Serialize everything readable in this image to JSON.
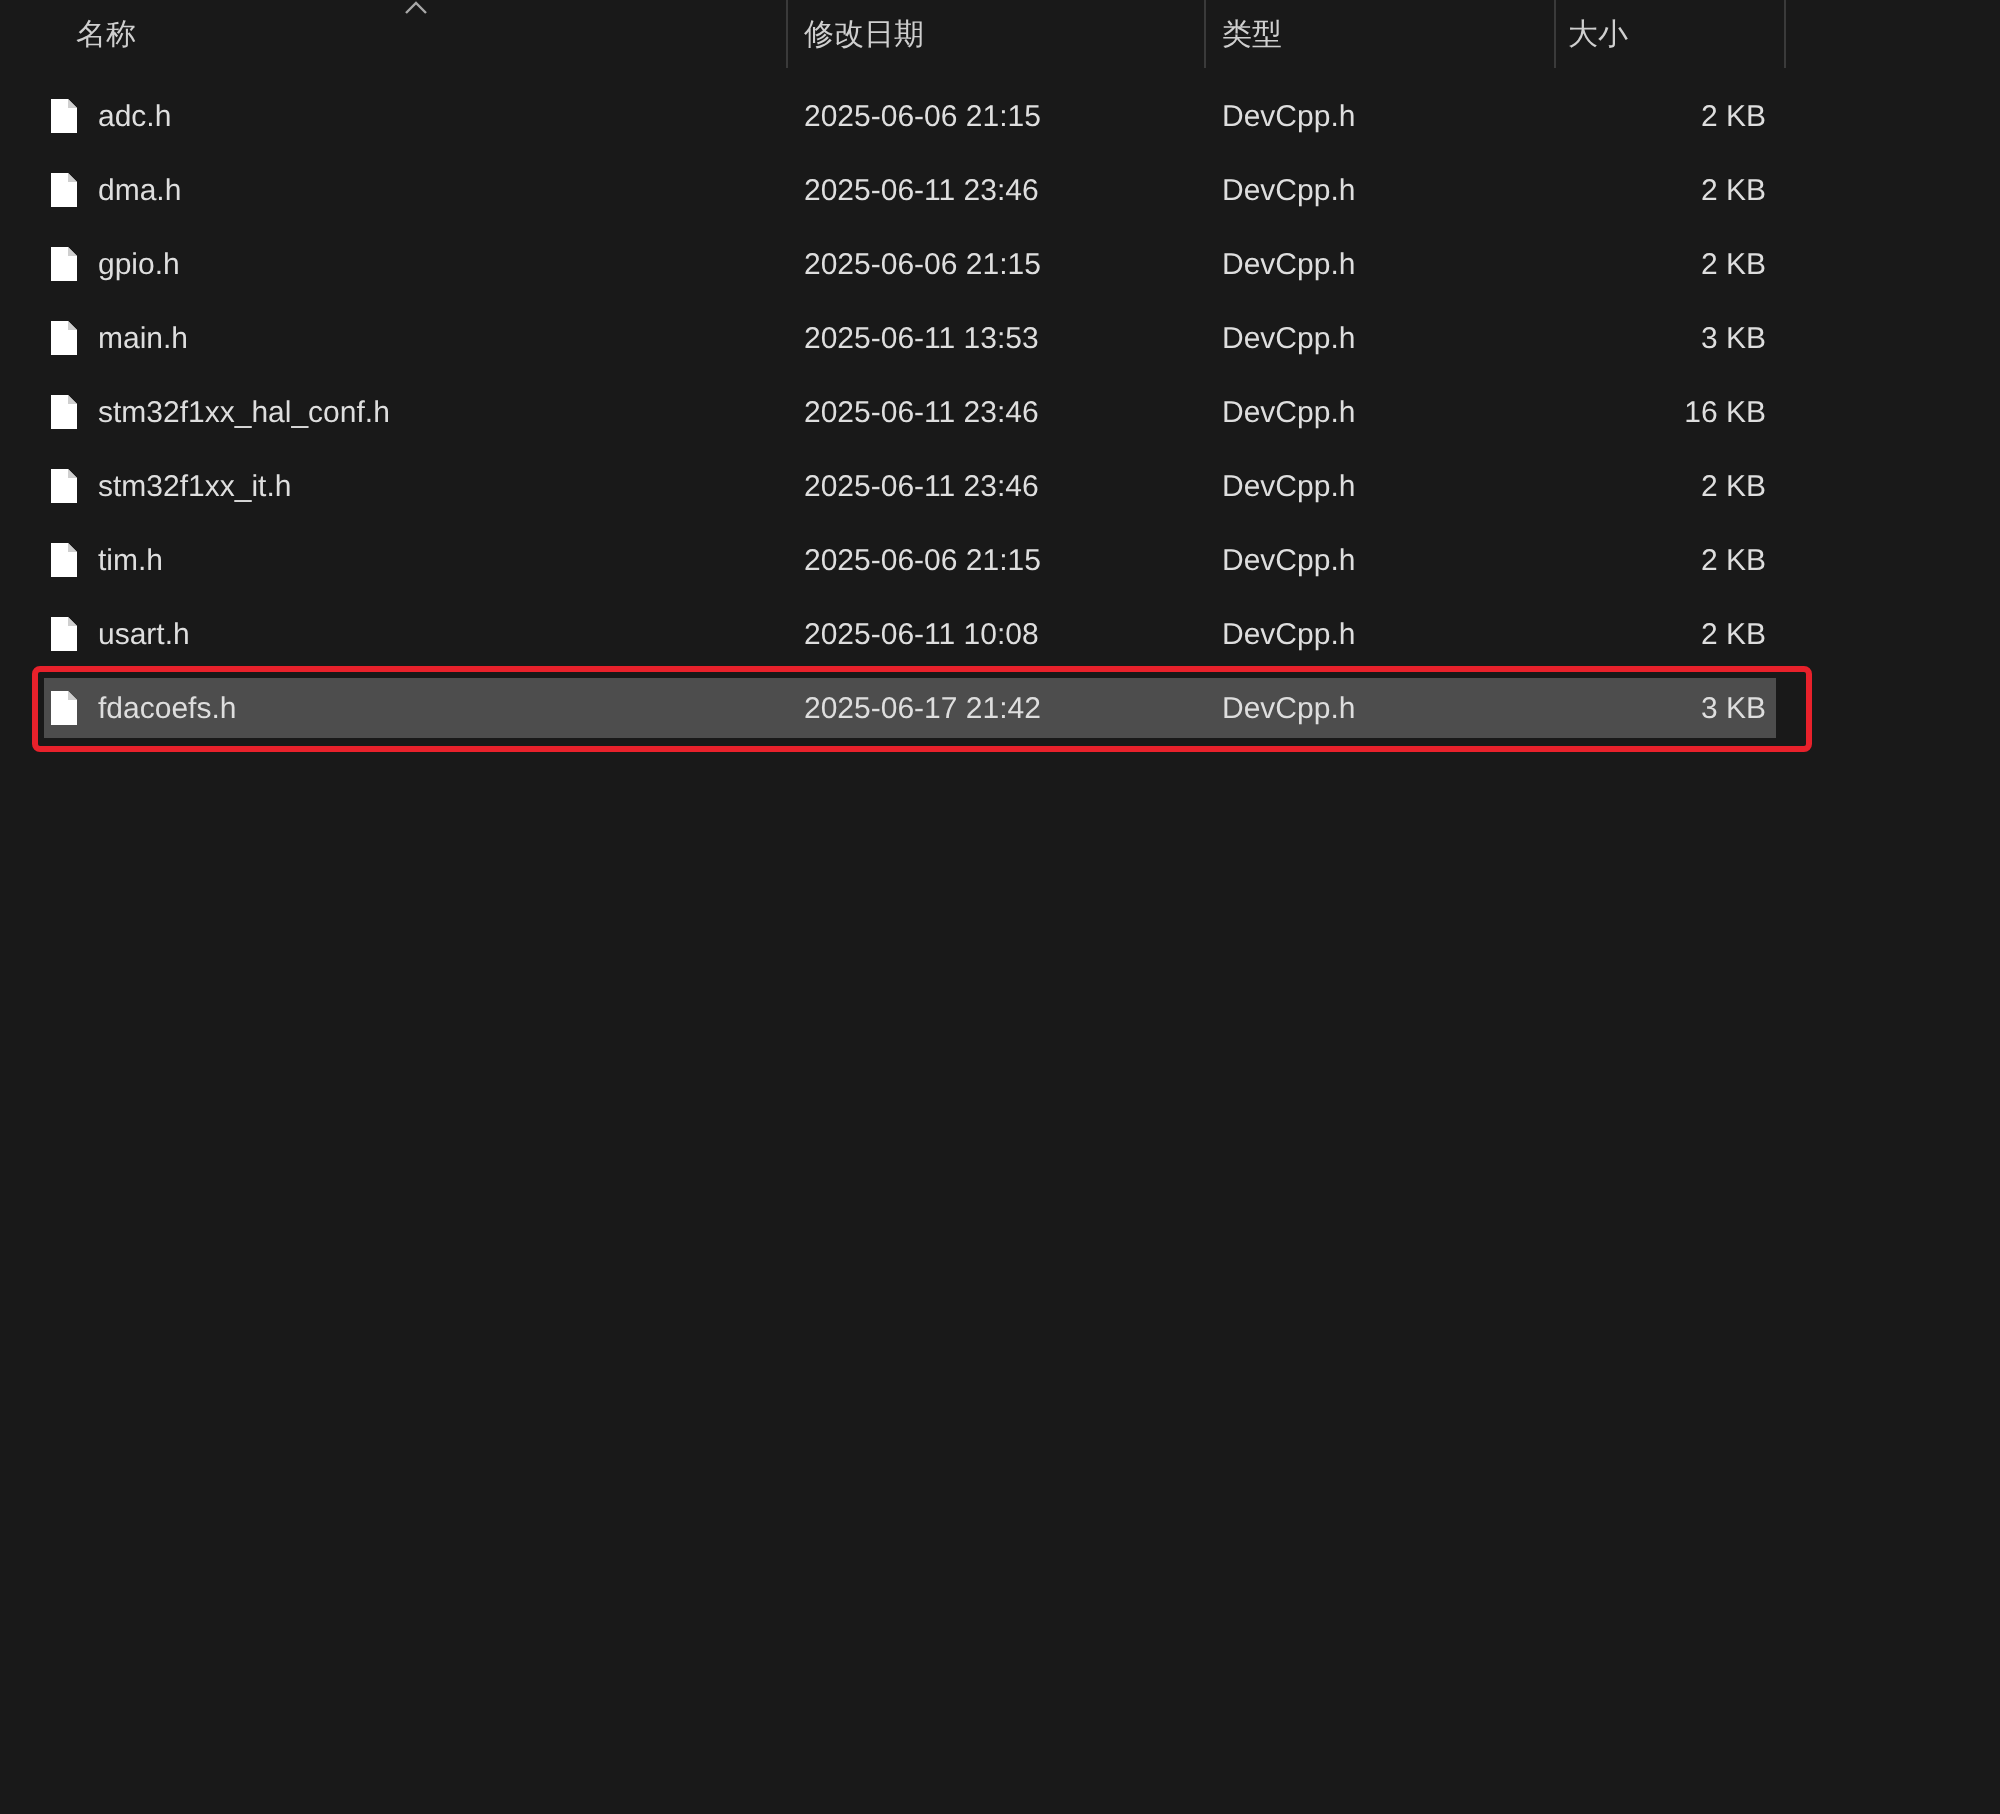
{
  "columns": [
    {
      "label": "名称",
      "sorted": true
    },
    {
      "label": "修改日期",
      "sorted": false
    },
    {
      "label": "类型",
      "sorted": false
    },
    {
      "label": "大小",
      "sorted": false
    }
  ],
  "files": [
    {
      "name": "adc.h",
      "modified": "2025-06-06 21:15",
      "type": "DevCpp.h",
      "size": "2 KB",
      "selected": false,
      "marked": false
    },
    {
      "name": "dma.h",
      "modified": "2025-06-11 23:46",
      "type": "DevCpp.h",
      "size": "2 KB",
      "selected": false,
      "marked": false
    },
    {
      "name": "gpio.h",
      "modified": "2025-06-06 21:15",
      "type": "DevCpp.h",
      "size": "2 KB",
      "selected": false,
      "marked": false
    },
    {
      "name": "main.h",
      "modified": "2025-06-11 13:53",
      "type": "DevCpp.h",
      "size": "3 KB",
      "selected": false,
      "marked": false
    },
    {
      "name": "stm32f1xx_hal_conf.h",
      "modified": "2025-06-11 23:46",
      "type": "DevCpp.h",
      "size": "16 KB",
      "selected": false,
      "marked": false
    },
    {
      "name": "stm32f1xx_it.h",
      "modified": "2025-06-11 23:46",
      "type": "DevCpp.h",
      "size": "2 KB",
      "selected": false,
      "marked": false
    },
    {
      "name": "tim.h",
      "modified": "2025-06-06 21:15",
      "type": "DevCpp.h",
      "size": "2 KB",
      "selected": false,
      "marked": false
    },
    {
      "name": "usart.h",
      "modified": "2025-06-11 10:08",
      "type": "DevCpp.h",
      "size": "2 KB",
      "selected": false,
      "marked": false
    },
    {
      "name": "fdacoefs.h",
      "modified": "2025-06-17 21:42",
      "type": "DevCpp.h",
      "size": "3 KB",
      "selected": true,
      "marked": true
    }
  ]
}
